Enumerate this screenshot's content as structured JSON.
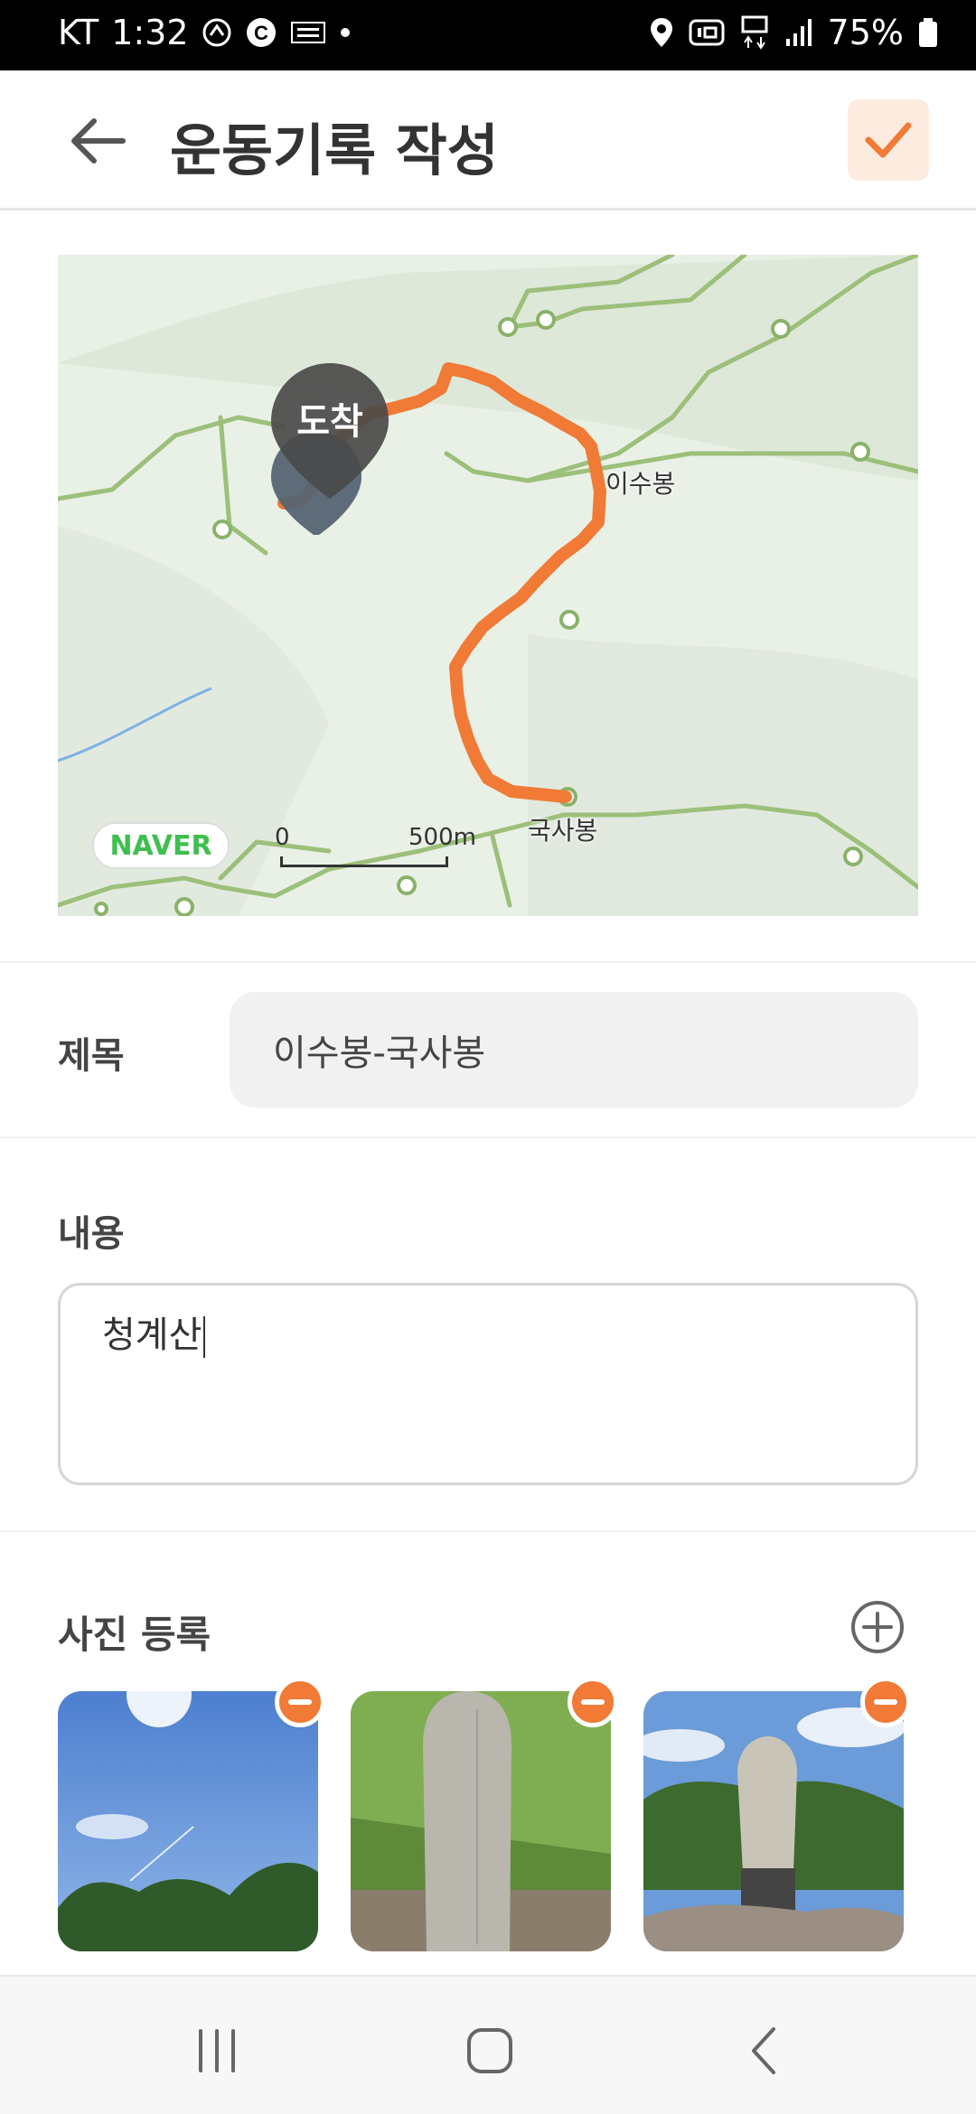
{
  "status_bar": {
    "carrier": "KT",
    "time": "1:32",
    "battery": "75%",
    "icons": [
      "runner-icon",
      "c-icon",
      "temu-icon",
      "dot-icon",
      "location-icon",
      "hd-icon",
      "5g-icon",
      "signal-icon",
      "battery-icon"
    ]
  },
  "header": {
    "title": "운동기록 작성",
    "back_icon": "arrow-left-icon",
    "confirm_icon": "check-icon",
    "accent": "#f07a36"
  },
  "map": {
    "pin_label": "도착",
    "places": [
      "이수봉",
      "국사봉"
    ],
    "brand": "NAVER",
    "scale_start": "0",
    "scale_distance": "500m",
    "route_color": "#f07a36"
  },
  "form": {
    "title_label": "제목",
    "title_value": "이수봉-국사봉",
    "content_label": "내용",
    "content_value": "청계산",
    "photo_label": "사진 등록",
    "photos_count": 3
  },
  "nav": {
    "recent": "recent-apps-icon",
    "home": "home-icon",
    "back": "back-icon"
  }
}
